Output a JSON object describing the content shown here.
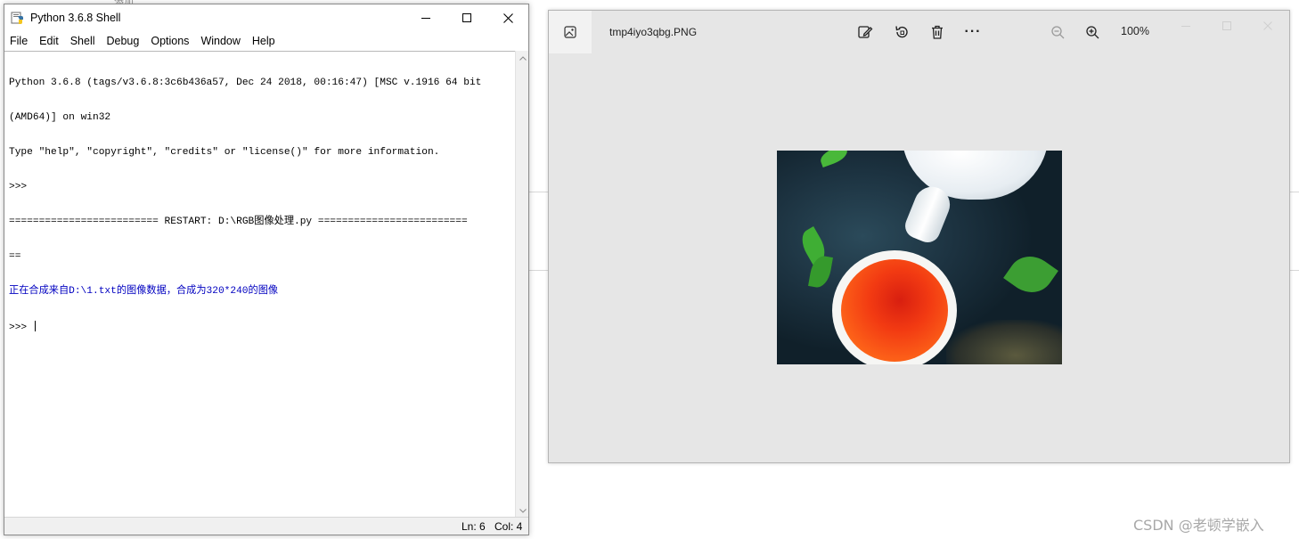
{
  "shell": {
    "title": "Python 3.6.8 Shell",
    "menu": [
      "File",
      "Edit",
      "Shell",
      "Debug",
      "Options",
      "Window",
      "Help"
    ],
    "lines": [
      "Python 3.6.8 (tags/v3.6.8:3c6b436a57, Dec 24 2018, 00:16:47) [MSC v.1916 64 bit",
      "(AMD64)] on win32",
      "Type \"help\", \"copyright\", \"credits\" or \"license()\" for more information.",
      ">>> ",
      "========================= RESTART: D:\\RGB图像处理.py =========================",
      "==",
      "正在合成来自D:\\1.txt的图像数据，合成为320*240的图像",
      ">>> "
    ],
    "status": {
      "ln": "Ln: 6",
      "col": "Col: 4"
    }
  },
  "viewer": {
    "filename": "tmp4iyo3qbg.PNG",
    "zoom": "100%",
    "tools": [
      "edit-icon",
      "rotate-icon",
      "delete-icon",
      "more-icon",
      "zoom-out-icon",
      "zoom-in-icon"
    ],
    "more_label": "···"
  },
  "watermark": "CSDN @老顿学嵌入",
  "background_fragments": [
    "添加"
  ]
}
